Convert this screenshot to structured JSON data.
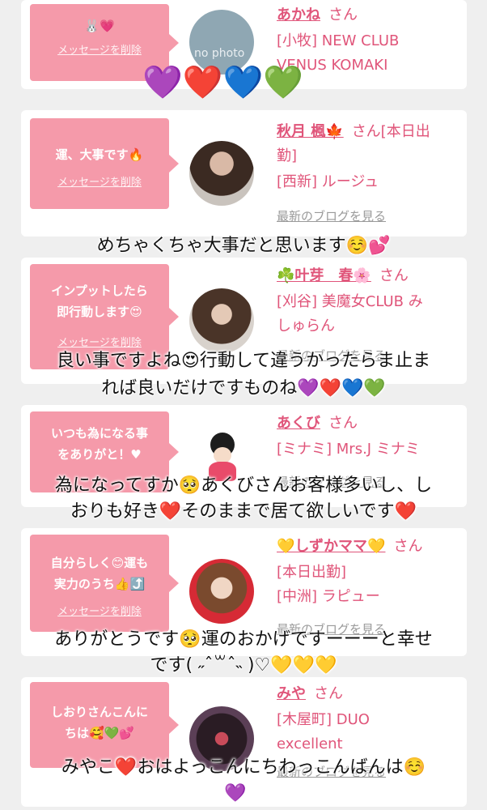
{
  "cards": [
    {
      "bubble_message": "🐰💗",
      "delete_label": "メッセージを削除",
      "name": "あかね",
      "san": "さん",
      "shop_lines": [
        "[小牧] NEW CLUB",
        "VENUS KOMAKI"
      ],
      "avatar_text": "no photo",
      "blog_link": ""
    },
    {
      "bubble_message": "運、大事です🔥",
      "delete_label": "メッセージを削除",
      "name": "秋月 楓🍁",
      "san": "さん[本日出",
      "name_cont": "勤]",
      "shop_lines": [
        "[西新] ルージュ"
      ],
      "blog_link": "最新のブログを見る"
    },
    {
      "bubble_message": "インプットしたら 即行動します😍",
      "delete_label": "メッセージを削除",
      "name": "☘️叶芽　春🌸",
      "san": "さん",
      "shop_lines": [
        "[刈谷] 美魔女CLUB み",
        "しゅらん"
      ],
      "blog_link": "最新のブログを見る"
    },
    {
      "bubble_message": "いつも為になる事 をありがと！♥",
      "delete_label": "",
      "name": "あくび",
      "san": "さん",
      "shop_lines": [
        "[ミナミ] Mrs.J ミナミ"
      ],
      "blog_link": "最新のブログを見る"
    },
    {
      "bubble_message": "自分らしく😊運も 実力のうち👍⤴️",
      "delete_label": "メッセージを削除",
      "name": "💛しずかママ💛",
      "san": "さん",
      "shop_lines": [
        "[本日出勤]",
        "[中洲] ラピュー"
      ],
      "blog_link": "最新のブログを見る"
    },
    {
      "bubble_message": "しおりさんこんに ちは🥰💚💕",
      "delete_label": "",
      "name": "みや",
      "san": "さん",
      "shop_lines": [
        "[木屋町] DUO",
        "excellent"
      ],
      "blog_link": "最新のブログを見る"
    }
  ],
  "overlays": {
    "hearts_top": "💜❤️💙💚",
    "caption_1": "めちゃくちゃ大事だと思います☺️💕",
    "caption_2_line1": "良い事ですよね😍行動して違うかったらま止ま",
    "caption_2_line2": "れば良いだけですものね💜❤️💙💚",
    "caption_3_line1": "為になってすか🥺あくびさんお客様多いし、し",
    "caption_3_line2": "おりも好き❤️そのままで居て欲しいです❤️",
    "caption_4_line1": "ありがとうです🥺運のおかげですーーーと幸せ",
    "caption_4_line2": "です( ˶ˆ꒳ˆ˵ )♡💛💛💛",
    "caption_5": "みやこ❤️おはよっこんにちわっこんばんは☺️",
    "caption_5_heart": "💜"
  },
  "colors": {
    "accent_pink": "#f59aaa",
    "name_pink": "#e0557a",
    "background": "#efefef"
  }
}
